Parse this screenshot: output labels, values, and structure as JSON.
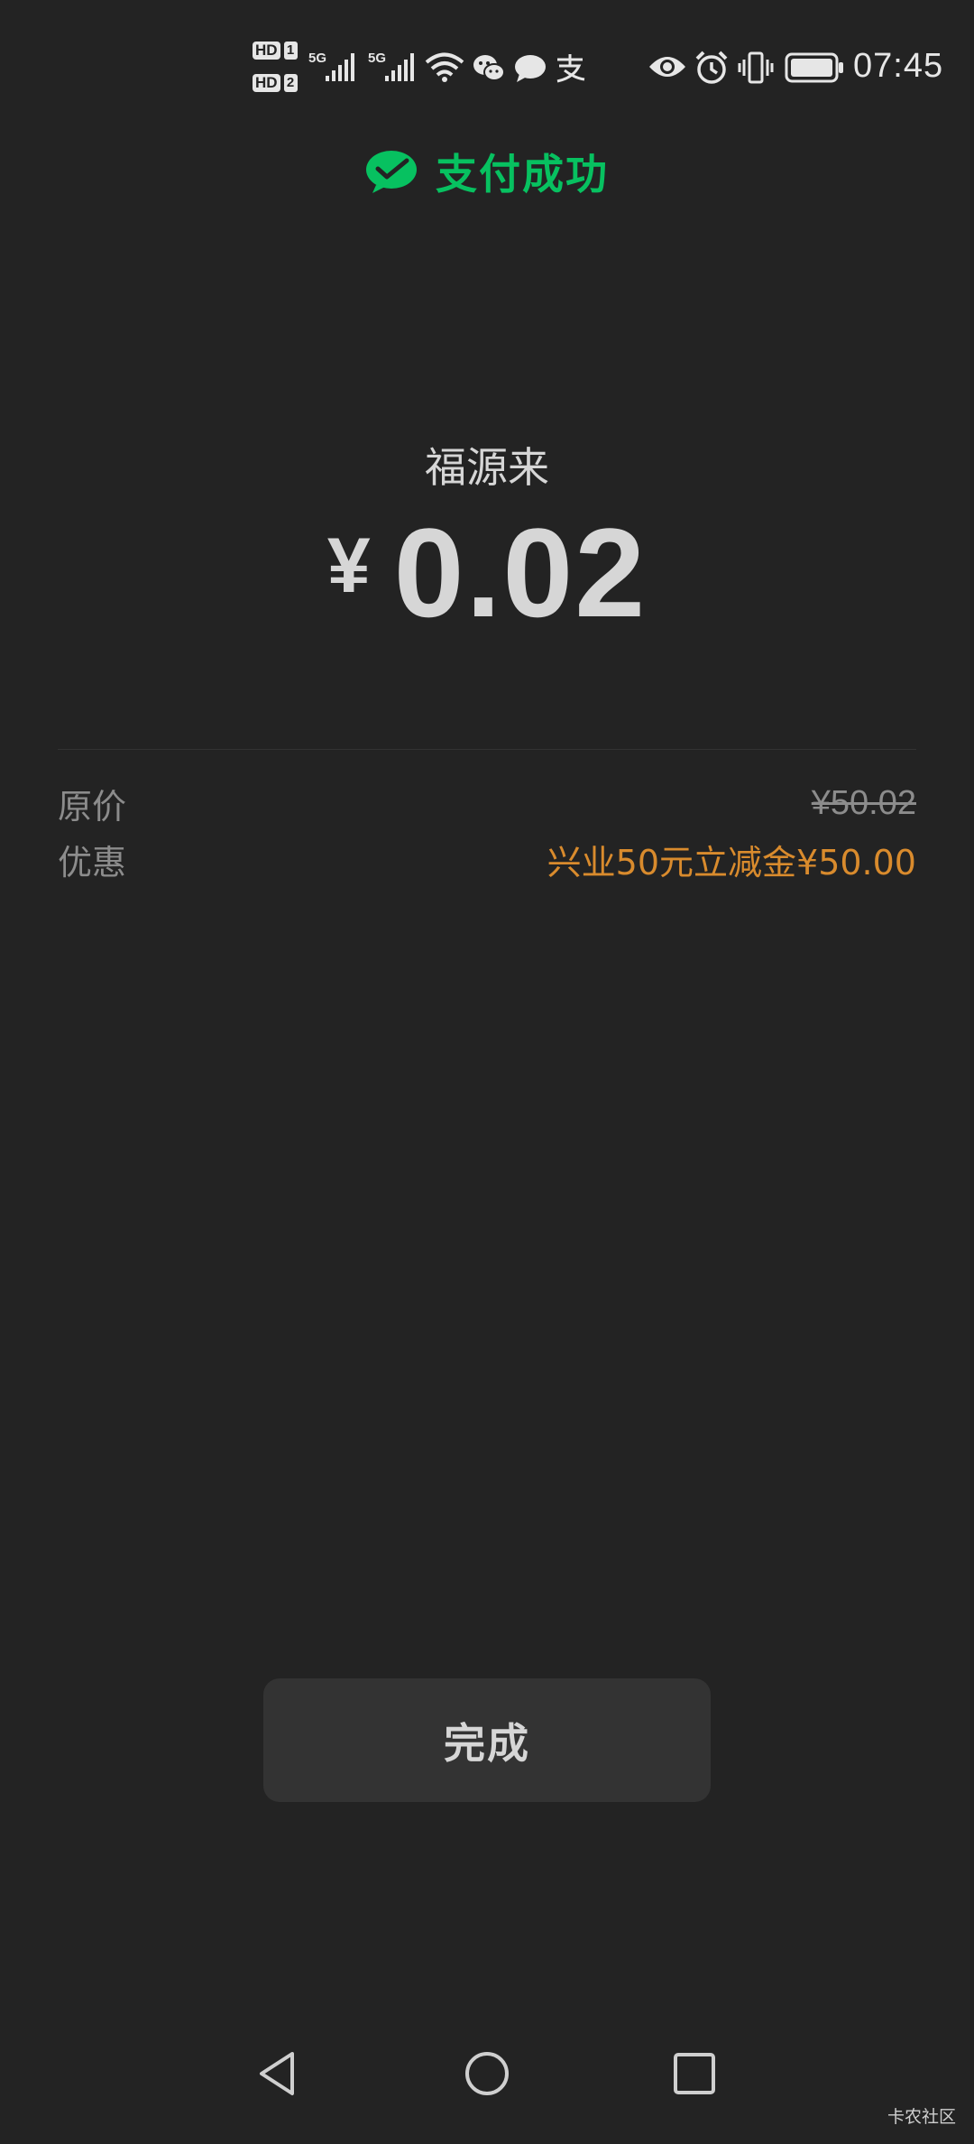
{
  "status_bar": {
    "sim1_badge": "HD",
    "sim1_number": "1",
    "sim2_badge": "HD",
    "sim2_number": "2",
    "network1": "5G",
    "network2": "5G",
    "icons": [
      "signal-icon",
      "signal-icon",
      "wifi-icon",
      "wechat-icon",
      "message-icon",
      "alipay-icon",
      "eye-icon",
      "alarm-icon",
      "vibrate-icon",
      "battery-icon"
    ],
    "time": "07:45"
  },
  "header": {
    "icon": "wechat-pay-icon",
    "title": "支付成功",
    "accent_color": "#07c160"
  },
  "payment": {
    "merchant": "福源来",
    "currency_symbol": "¥",
    "amount": "0.02"
  },
  "details": [
    {
      "label": "原价",
      "value": "¥50.02",
      "style": "strikethrough"
    },
    {
      "label": "优惠",
      "value": "兴业50元立减金¥50.00",
      "style": "discount",
      "color": "#d98b2d"
    }
  ],
  "actions": {
    "done_label": "完成"
  },
  "nav_bar": {
    "icons": [
      "back-triangle-icon",
      "home-circle-icon",
      "recent-square-icon"
    ]
  },
  "watermark": "卡农社区"
}
